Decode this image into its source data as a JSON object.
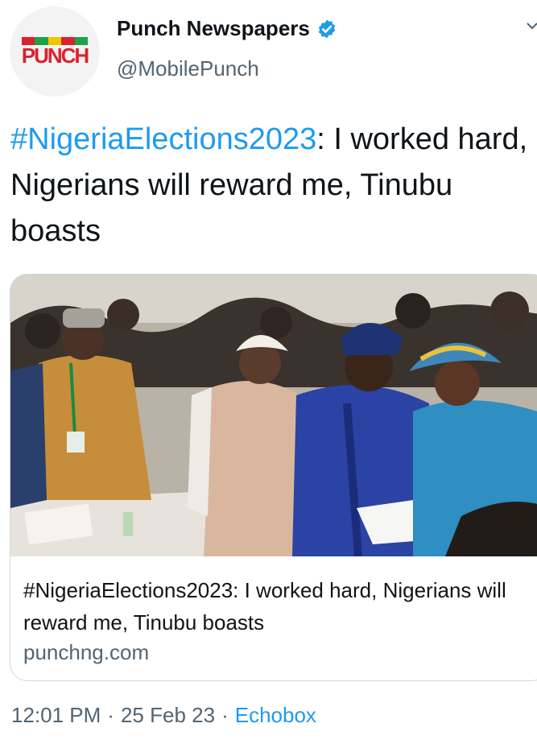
{
  "account": {
    "display_name": "Punch Newspapers",
    "handle": "@MobilePunch",
    "verified": true,
    "avatar_logo_text": "PUNCH",
    "avatar_icon": "punch-logo"
  },
  "tweet": {
    "hashtag": "#NigeriaElections2023",
    "body": ": I worked hard, Nigerians will reward me, Tinubu boasts"
  },
  "card": {
    "image_icon": "news-photo",
    "title": "#NigeriaElections2023: I worked hard, Nigerians will reward me, Tinubu boasts",
    "domain": "punchng.com"
  },
  "meta": {
    "time": "12:01 PM",
    "separator": "·",
    "date": "25 Feb 23",
    "source": "Echobox"
  },
  "colors": {
    "link": "#1d9bf0",
    "secondary_text": "#536471",
    "border": "#cfd9de",
    "punch_red": "#d9232e"
  }
}
